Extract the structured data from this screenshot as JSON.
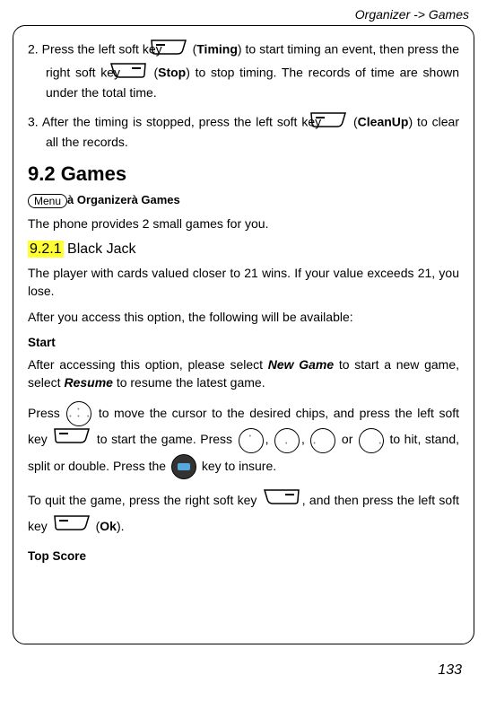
{
  "header": "Organizer -> Games",
  "step2": {
    "num": "2.",
    "t1": " Press the left soft key ",
    "timing": "Timing",
    "t2": " to start timing an event, then press the right soft key ",
    "stop": "Stop",
    "t3": " to stop timing. The records of time are shown under the total time."
  },
  "step3": {
    "num": "3.",
    "t1": " After the timing is stopped, press the left soft key ",
    "cleanup": "CleanUp",
    "t2": " to clear all the records."
  },
  "section_title": "9.2 Games",
  "breadcrumb": {
    "menu": "Menu",
    "sep1": "à",
    "b1": " Organizer",
    "sep2": "à",
    "b2": " Games"
  },
  "intro": "The phone provides 2 small games for you.",
  "subsect": {
    "num": "9.2.1",
    "title": " Black Jack"
  },
  "bj_desc": "The player with cards valued closer to 21 wins. If your value exceeds 21, you lose.",
  "bj_after": "After you access this option, the following will be available:",
  "start_label": "Start",
  "start_para": {
    "t1": "After accessing this option, please select ",
    "newgame": "New Game",
    "t2": " to start a new game, select ",
    "resume": "Resume",
    "t3": " to resume the latest game."
  },
  "play": {
    "t1": "Press ",
    "t2": " to move the cursor to the desired chips, and press the left soft key ",
    "t3": " to start the game. Press ",
    "comma1": ", ",
    "comma2": ", ",
    "or": " or ",
    "t4": " to hit, stand, split or double. Press the ",
    "t5": " key to insure."
  },
  "quit": {
    "t1": "To quit the game, press the right soft key ",
    "t2": ", and then press the left soft key ",
    "ok": "Ok",
    "t3": "."
  },
  "topscore": "Top Score",
  "pagenum": "133"
}
